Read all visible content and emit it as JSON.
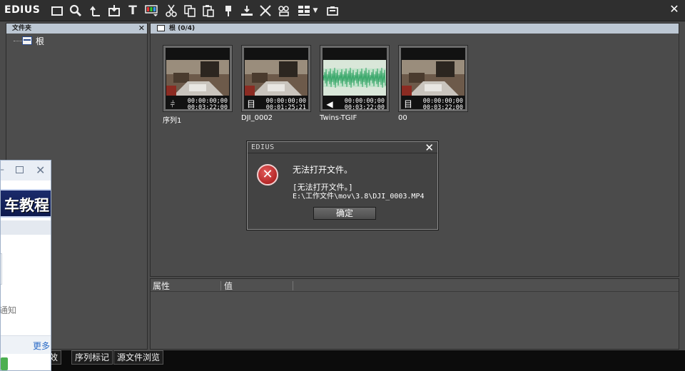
{
  "app": {
    "title": "EDIUS",
    "close_icon": "close-icon"
  },
  "toolbar": {
    "icons": [
      "new-folder-icon",
      "search-icon",
      "up-folder-icon",
      "import-icon",
      "title-icon",
      "color-bars-icon",
      "cut-icon",
      "copy-icon",
      "paste-icon",
      "marker-icon",
      "insert-to-timeline-icon",
      "delete-icon",
      "properties-icon",
      "view-mode-icon",
      "dropdown-icon",
      "capture-icon"
    ]
  },
  "folder_panel": {
    "header": "文件夹",
    "root_label": "根"
  },
  "bin": {
    "header": "根 (0/4)",
    "clips": [
      {
        "name": "序列1",
        "type": "sequence",
        "tc_in": "00:00:00;00",
        "tc_dur": "00:03:22;00",
        "thumb": "video",
        "marked": false
      },
      {
        "name": "DJI_0002",
        "type": "video",
        "tc_in": "00:00:00;00",
        "tc_dur": "00:01:25;21",
        "thumb": "video",
        "marked": true
      },
      {
        "name": "Twins-TGIF",
        "type": "audio",
        "tc_in": "00:00:00;00",
        "tc_dur": "00:03:22;00",
        "thumb": "audio",
        "marked": true
      },
      {
        "name": "00",
        "type": "video",
        "tc_in": "00:00:00;00",
        "tc_dur": "00:03:22;00",
        "thumb": "video",
        "marked": false
      }
    ]
  },
  "properties": {
    "col_property": "属性",
    "col_value": "值"
  },
  "tabs": [
    {
      "label": "效"
    },
    {
      "label": "序列标记"
    },
    {
      "label": "源文件浏览"
    }
  ],
  "side_window": {
    "banner": "车教程",
    "notify": "通知",
    "more": "更多"
  },
  "dialog": {
    "title": "EDIUS",
    "message": "无法打开文件。",
    "detail_line1": "[无法打开文件。]",
    "detail_line2": "E:\\工作文件\\mov\\3.8\\DJI_0003.MP4",
    "ok_label": "确定",
    "icon": "error-icon"
  },
  "colors": {
    "header_bar": "#bcc7d3",
    "panel_bg": "#4b4b4b",
    "mark_green": "#3ccf3c",
    "error_red": "#c31d1d",
    "link_blue": "#2b6bc6"
  }
}
